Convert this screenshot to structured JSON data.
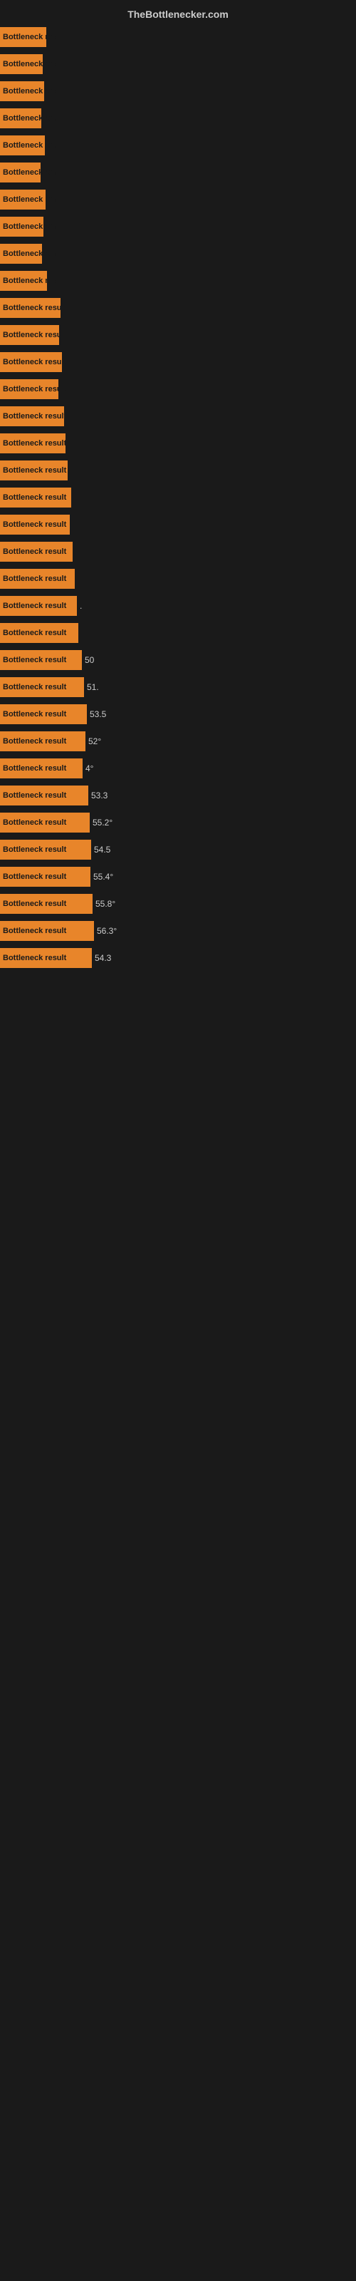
{
  "header": {
    "title": "TheBottlenecker.com"
  },
  "bars": [
    {
      "label": "Bottleneck res",
      "width": 65,
      "value": ""
    },
    {
      "label": "Bottleneck res",
      "width": 60,
      "value": ""
    },
    {
      "label": "Bottleneck res",
      "width": 62,
      "value": ""
    },
    {
      "label": "Bottleneck res",
      "width": 58,
      "value": ""
    },
    {
      "label": "Bottleneck res",
      "width": 63,
      "value": ""
    },
    {
      "label": "Bottleneck res",
      "width": 57,
      "value": ""
    },
    {
      "label": "Bottleneck res",
      "width": 64,
      "value": ""
    },
    {
      "label": "Bottleneck res",
      "width": 61,
      "value": ""
    },
    {
      "label": "Bottleneck res",
      "width": 59,
      "value": ""
    },
    {
      "label": "Bottleneck res",
      "width": 66,
      "value": ""
    },
    {
      "label": "Bottleneck result",
      "width": 85,
      "value": ""
    },
    {
      "label": "Bottleneck result",
      "width": 83,
      "value": ""
    },
    {
      "label": "Bottleneck result",
      "width": 87,
      "value": ""
    },
    {
      "label": "Bottleneck result",
      "width": 82,
      "value": ""
    },
    {
      "label": "Bottleneck result",
      "width": 90,
      "value": ""
    },
    {
      "label": "Bottleneck result",
      "width": 92,
      "value": ""
    },
    {
      "label": "Bottleneck result",
      "width": 95,
      "value": ""
    },
    {
      "label": "Bottleneck result",
      "width": 100,
      "value": ""
    },
    {
      "label": "Bottleneck result",
      "width": 98,
      "value": ""
    },
    {
      "label": "Bottleneck result",
      "width": 102,
      "value": ""
    },
    {
      "label": "Bottleneck result",
      "width": 105,
      "value": ""
    },
    {
      "label": "Bottleneck result",
      "width": 108,
      "value": "."
    },
    {
      "label": "Bottleneck result",
      "width": 110,
      "value": ""
    },
    {
      "label": "Bottleneck result",
      "width": 115,
      "value": "50"
    },
    {
      "label": "Bottleneck result",
      "width": 118,
      "value": "51."
    },
    {
      "label": "Bottleneck result",
      "width": 122,
      "value": "53.5"
    },
    {
      "label": "Bottleneck result",
      "width": 120,
      "value": "52°"
    },
    {
      "label": "Bottleneck result",
      "width": 116,
      "value": "4°"
    },
    {
      "label": "Bottleneck result",
      "width": 124,
      "value": "53.3"
    },
    {
      "label": "Bottleneck result",
      "width": 126,
      "value": "55.2°"
    },
    {
      "label": "Bottleneck result",
      "width": 128,
      "value": "54.5"
    },
    {
      "label": "Bottleneck result",
      "width": 127,
      "value": "55.4°"
    },
    {
      "label": "Bottleneck result",
      "width": 130,
      "value": "55.8°"
    },
    {
      "label": "Bottleneck result",
      "width": 132,
      "value": "56.3°"
    },
    {
      "label": "Bottleneck result",
      "width": 129,
      "value": "54.3"
    }
  ]
}
